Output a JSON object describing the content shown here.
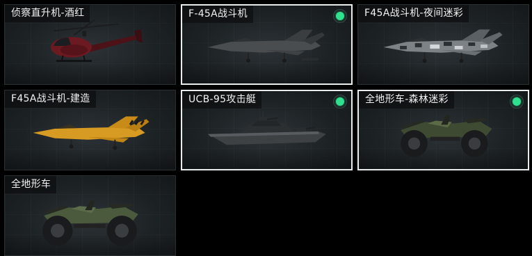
{
  "vehicles": [
    {
      "label": "侦察直升机-酒红",
      "selected": false,
      "owned": false,
      "kind": "helicopter",
      "icon": "helicopter-icon",
      "color": "#6b1a22"
    },
    {
      "label": "F-45A战斗机",
      "selected": true,
      "owned": true,
      "kind": "jet",
      "icon": "fighter-jet-icon",
      "color": "#4a4d50"
    },
    {
      "label": "F45A战斗机-夜间迷彩",
      "selected": false,
      "owned": false,
      "kind": "jet",
      "icon": "fighter-jet-icon",
      "color": "#7d8287"
    },
    {
      "label": "F45A战斗机-建造",
      "selected": false,
      "owned": false,
      "kind": "jet",
      "icon": "fighter-jet-icon",
      "color": "#d79a22"
    },
    {
      "label": "UCB-95攻击艇",
      "selected": true,
      "owned": true,
      "kind": "boat",
      "icon": "attack-boat-icon",
      "color": "#3d4144"
    },
    {
      "label": "全地形车-森林迷彩",
      "selected": true,
      "owned": true,
      "kind": "atv",
      "icon": "atv-icon",
      "color": "#3f4a33"
    },
    {
      "label": "全地形车",
      "selected": false,
      "owned": false,
      "kind": "atv",
      "icon": "atv-icon",
      "color": "#4b5a3c"
    }
  ],
  "accent": "#2fe08f"
}
